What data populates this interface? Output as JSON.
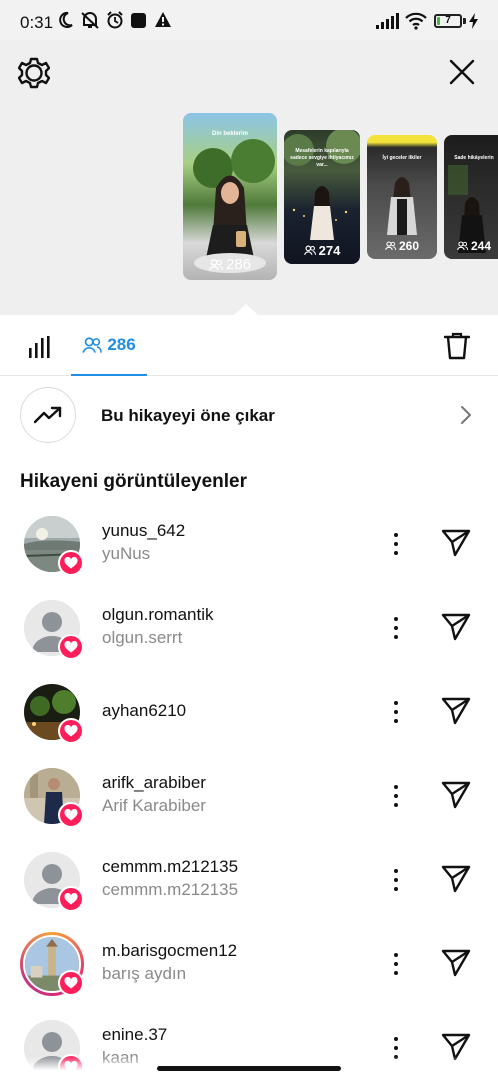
{
  "status_bar": {
    "time": "0:31",
    "battery_level": "7",
    "battery_fraction": 0.07
  },
  "header": {
    "settings_icon": "gear-icon",
    "close_icon": "close-icon"
  },
  "stories": [
    {
      "caption": "Din beklerim",
      "viewers": "286",
      "selected": true
    },
    {
      "caption": "Mesafelerin kapılarıyla sadece sevgiye ihtiyacımız var...",
      "viewers": "274",
      "selected": false
    },
    {
      "caption": "İyi geceler ilkiler",
      "viewers": "260",
      "selected": false
    },
    {
      "caption": "Sade hikâyelerin",
      "viewers": "244",
      "selected": false
    }
  ],
  "tabs": {
    "insights_icon": "bar-chart-icon",
    "viewers_count": "286",
    "delete_icon": "trash-icon"
  },
  "promote": {
    "label": "Bu hikayeyi öne çıkar",
    "icon": "trending-up-icon"
  },
  "viewers_section": {
    "title": "Hikayeni görüntüleyenler",
    "viewers": [
      {
        "username": "yunus_642",
        "full_name": "yuNus",
        "avatar": "photo-lake",
        "liked": true
      },
      {
        "username": "olgun.romantik",
        "full_name": "olgun.serrt",
        "avatar": "default",
        "liked": true
      },
      {
        "username": "ayhan6210",
        "full_name": "",
        "avatar": "photo-night",
        "liked": true
      },
      {
        "username": "arifk_arabiber",
        "full_name": "Arif Karabiber",
        "avatar": "photo-man",
        "liked": true
      },
      {
        "username": "cemmm.m212135",
        "full_name": "cemmm.m212135",
        "avatar": "default",
        "liked": true
      },
      {
        "username": "m.barisgocmen12",
        "full_name": "barış aydın",
        "avatar": "photo-tower",
        "liked": true
      },
      {
        "username": "enine.37",
        "full_name": "kaan",
        "avatar": "default",
        "liked": true
      }
    ]
  },
  "colors": {
    "accent": "#1f8ee6",
    "heart": "#ff1e5a",
    "header_bg": "#efefef"
  }
}
